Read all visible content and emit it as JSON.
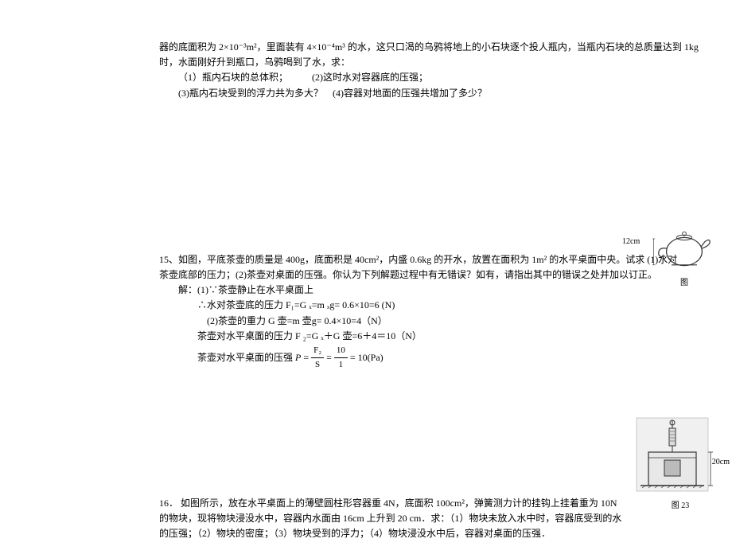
{
  "problem14": {
    "line1": "器的底面积为 2×10⁻³m²，里面装有 4×10⁻⁴m³ 的水，这只口渴的乌鸦将地上的小石块逐个投人瓶内，当瓶内石块的总质量达到 1kg",
    "line2": "时，水面刚好升到瓶口，乌鸦喝到了水，求：",
    "line3": "（1）瓶内石块的总体积；　　　(2)这时水对容器底的压强；",
    "line4": "(3)瓶内石块受到的浮力共为多大？　(4)容器对地面的压强共增加了多少？"
  },
  "problem15": {
    "intro1": "15、如图，平底茶壶的质量是 400g，底面积是 40cm²，内盛 0.6kg 的开水，放置在面积为 1m² 的水平桌面中央。试求 (1)水对",
    "intro2": "茶壶底部的压力；(2)茶壶对桌面的压强。你认为下列解题过程中有无错误？如有，请指出其中的错误之处并加以订正。",
    "sol1": "解：(1)∵茶壶静止在水平桌面上",
    "sol2": "∴水对茶壶底的压力 F₁=G ₓ=m ₓg= 0.6×10=6 (N)",
    "sol3": "(2)茶壶的重力 G 壶=m 壶g= 0.4×10=4（N）",
    "sol4": "茶壶对水平桌面的压力 F ₂=G ₓ＋G 壶=6＋4＝10（N）",
    "sol5_prefix": "茶壶对水平桌面的压强 ",
    "sol5_p": "P",
    "sol5_eq": " = ",
    "sol5_num1": "F₂",
    "sol5_den1": "S",
    "sol5_num2": "10",
    "sol5_den2": "1",
    "sol5_result": " = 10(Pa)"
  },
  "problem16": {
    "line1": "16． 如图所示，放在水平桌面上的薄壁圆柱形容器重 4N，底面积 100cm²，弹簧测力计的挂钩上挂着重为 10N",
    "line2": "的物块，现将物块浸没水中，容器内水面由 16cm 上升到 20 cm．求：（1）物块未放入水中时，容器底受到的水",
    "line3": "的压强；（2）物块的密度；（3）物块受到的浮力；（4）物块浸没水中后，容器对桌面的压强．"
  },
  "figures": {
    "teapot_height": "12cm",
    "teapot_caption": "图",
    "container_height": "20cm",
    "container_caption": "图 23"
  }
}
